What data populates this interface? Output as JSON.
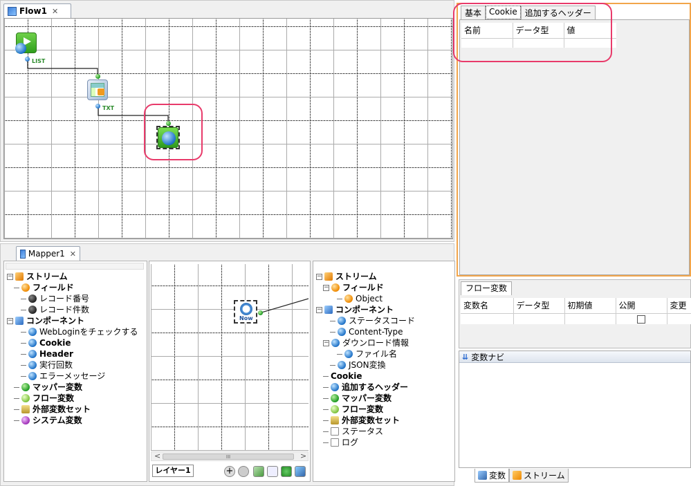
{
  "flow_tab": {
    "label": "Flow1",
    "close": "✕"
  },
  "flow_ports": {
    "p1": "LIST",
    "p2": "TXT"
  },
  "mapper_tab": {
    "label": "Mapper1",
    "close": "✕"
  },
  "props": {
    "tabs": [
      "基本",
      "Cookie",
      "追加するヘッダー"
    ],
    "columns": [
      "名前",
      "データ型",
      "値"
    ]
  },
  "flowvars": {
    "tab": "フロー変数",
    "columns": [
      "変数名",
      "データ型",
      "初期値",
      "公開",
      "変更"
    ]
  },
  "varnavi": {
    "label": "変数ナビ"
  },
  "bottom_tabs": [
    "変数",
    "ストリーム"
  ],
  "left_tree": [
    {
      "label": "ストリーム",
      "icon": "stream",
      "bold": true,
      "indent": 0,
      "exp": "−"
    },
    {
      "label": "フィールド",
      "icon": "orange",
      "bold": true,
      "indent": 1
    },
    {
      "label": "レコード番号",
      "icon": "dark",
      "indent": 2
    },
    {
      "label": "レコード件数",
      "icon": "dark",
      "indent": 2
    },
    {
      "label": "コンポーネント",
      "icon": "comp",
      "bold": true,
      "indent": 0,
      "exp": "−"
    },
    {
      "label": "WebLoginをチェックする",
      "icon": "blue",
      "indent": 2
    },
    {
      "label": "Cookie",
      "icon": "blue",
      "bold": true,
      "indent": 2
    },
    {
      "label": "Header",
      "icon": "blue",
      "bold": true,
      "indent": 2
    },
    {
      "label": "実行回数",
      "icon": "blue",
      "indent": 2
    },
    {
      "label": "エラーメッセージ",
      "icon": "blue",
      "indent": 2
    },
    {
      "label": "マッパー変数",
      "icon": "green",
      "bold": true,
      "indent": 1
    },
    {
      "label": "フロー変数",
      "icon": "lgreen",
      "bold": true,
      "indent": 1
    },
    {
      "label": "外部変数セット",
      "icon": "ext",
      "bold": true,
      "indent": 1
    },
    {
      "label": "システム変数",
      "icon": "purple",
      "bold": true,
      "indent": 1
    }
  ],
  "right_tree": [
    {
      "label": "ストリーム",
      "icon": "stream",
      "bold": true,
      "indent": 0,
      "exp": "−"
    },
    {
      "label": "フィールド",
      "icon": "orange",
      "bold": true,
      "indent": 1,
      "exp": "−"
    },
    {
      "label": "Object",
      "icon": "orange",
      "indent": 3
    },
    {
      "label": "コンポーネント",
      "icon": "comp",
      "bold": true,
      "indent": 0,
      "exp": "−"
    },
    {
      "label": "ステータスコード",
      "icon": "blue",
      "indent": 2
    },
    {
      "label": "Content-Type",
      "icon": "blue",
      "indent": 2
    },
    {
      "label": "ダウンロード情報",
      "icon": "blue",
      "indent": 1,
      "exp": "−"
    },
    {
      "label": "ファイル名",
      "icon": "blue",
      "indent": 3
    },
    {
      "label": "JSON変換",
      "icon": "blue",
      "indent": 2
    },
    {
      "label": "Cookie",
      "icon": "none",
      "bold": true,
      "indent": 1
    },
    {
      "label": "追加するヘッダー",
      "icon": "blue",
      "bold": true,
      "indent": 1
    },
    {
      "label": "マッパー変数",
      "icon": "green",
      "bold": true,
      "indent": 1
    },
    {
      "label": "フロー変数",
      "icon": "lgreen",
      "bold": true,
      "indent": 1
    },
    {
      "label": "外部変数セット",
      "icon": "ext",
      "bold": true,
      "indent": 1
    },
    {
      "label": "ステータス",
      "icon": "doc",
      "indent": 1
    },
    {
      "label": "ログ",
      "icon": "doc",
      "indent": 1
    }
  ],
  "mapper_node": {
    "label": "Now"
  },
  "layer_tab": {
    "label": "レイヤー1"
  },
  "scroll": {
    "left": "<",
    "mid": "III",
    "right": ">"
  }
}
